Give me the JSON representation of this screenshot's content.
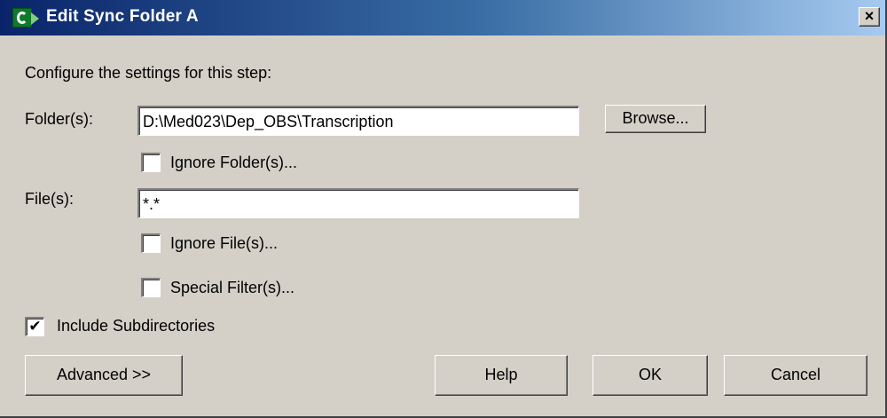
{
  "window": {
    "title": "Edit Sync Folder A",
    "close_glyph": "×",
    "icon": "sync-app-icon"
  },
  "intro": "Configure the settings for this step:",
  "folders": {
    "label": "Folder(s):",
    "value": "D:\\Med023\\Dep_OBS\\Transcription",
    "browse_label": "Browse...",
    "ignore_label": "Ignore Folder(s)...",
    "ignore_checked": false
  },
  "files": {
    "label": "File(s):",
    "value": "*.*",
    "ignore_label": "Ignore File(s)...",
    "ignore_checked": false,
    "special_filter_label": "Special Filter(s)...",
    "special_filter_checked": false
  },
  "include_subdirectories": {
    "label": "Include Subdirectories",
    "checked": true,
    "check_glyph": "✔"
  },
  "buttons": {
    "advanced": "Advanced >>",
    "help": "Help",
    "ok": "OK",
    "cancel": "Cancel"
  },
  "colors": {
    "face": "#d4d0c8",
    "title_start": "#0a246a",
    "title_end": "#a6caf0"
  }
}
